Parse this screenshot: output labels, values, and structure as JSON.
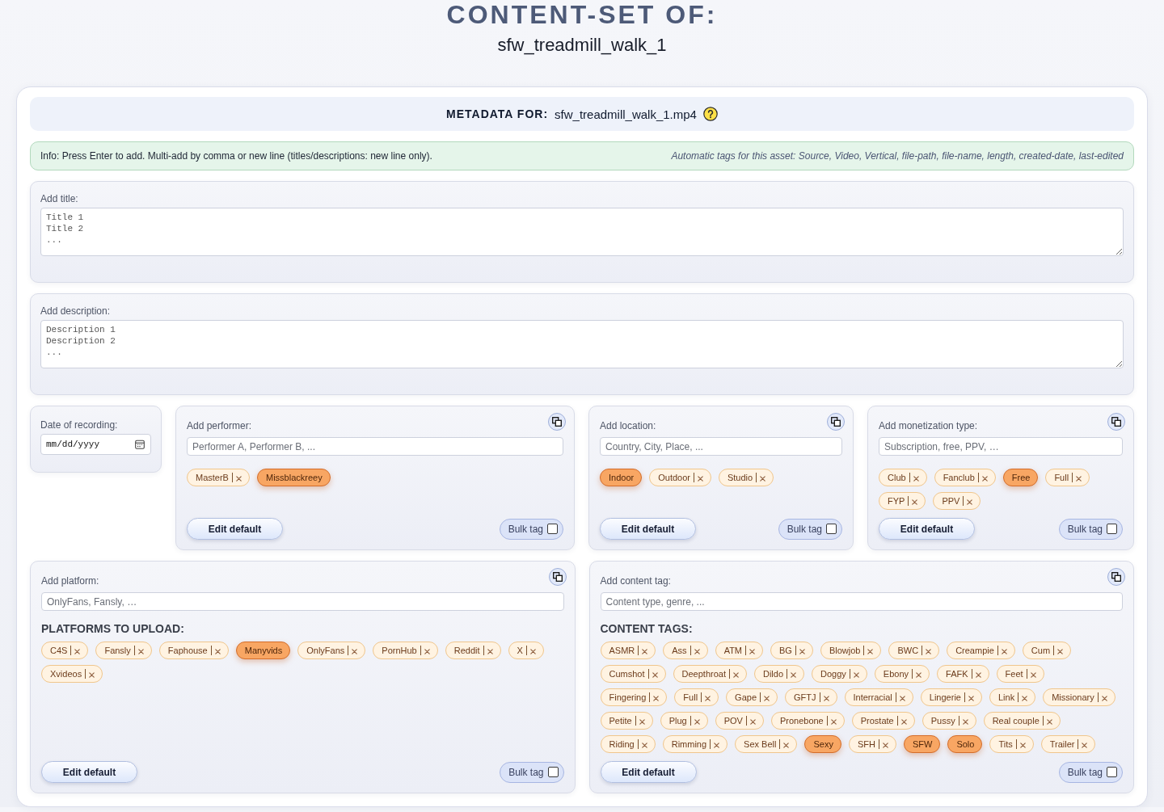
{
  "header": {
    "title": "CONTENT-SET OF:",
    "subtitle": "sfw_treadmill_walk_1"
  },
  "metadata_bar": {
    "label": "METADATA FOR:",
    "filename": "sfw_treadmill_walk_1.mp4"
  },
  "info_bar": {
    "hint": "Info: Press Enter to add. Multi-add by comma or new line (titles/descriptions: new line only).",
    "automatic_tags": "Automatic tags for this asset: Source, Video, Vertical, file-path, file-name, length, created-date, last-edited"
  },
  "text_fields": [
    {
      "label": "Add title:",
      "placeholder": "Title 1\nTitle 2\n..."
    },
    {
      "label": "Add description:",
      "placeholder": "Description 1\nDescription 2\n..."
    }
  ],
  "date_field": {
    "label": "Date of recording:",
    "placeholder": "mm/dd/yyyy"
  },
  "tag_panels": [
    {
      "label": "Add performer:",
      "placeholder": "Performer A, Performer B, ...",
      "tags": [
        {
          "label": "MasterB",
          "selected": false
        },
        {
          "label": "Missblackreey",
          "selected": true
        }
      ],
      "edit_button": "Edit default",
      "bulk_tag": {
        "label": "Bulk tag",
        "checked": false
      }
    },
    {
      "label": "Add location:",
      "placeholder": "Country, City, Place, ...",
      "tags": [
        {
          "label": "Indoor",
          "selected": true
        },
        {
          "label": "Outdoor",
          "selected": false
        },
        {
          "label": "Studio",
          "selected": false
        }
      ],
      "edit_button": "Edit default",
      "bulk_tag": {
        "label": "Bulk tag",
        "checked": false
      }
    },
    {
      "label": "Add monetization type:",
      "placeholder": "Subscription, free, PPV, …",
      "tags": [
        {
          "label": "Club",
          "selected": false
        },
        {
          "label": "Fanclub",
          "selected": false
        },
        {
          "label": "Free",
          "selected": true
        },
        {
          "label": "Full",
          "selected": false
        },
        {
          "label": "FYP",
          "selected": false
        },
        {
          "label": "PPV",
          "selected": false
        }
      ],
      "edit_button": "Edit default",
      "bulk_tag": {
        "label": "Bulk tag",
        "checked": false
      }
    },
    {
      "label": "Add platform:",
      "placeholder": "OnlyFans, Fansly, …",
      "heading": "PLATFORMS TO UPLOAD:",
      "tags": [
        {
          "label": "C4S",
          "selected": false
        },
        {
          "label": "Fansly",
          "selected": false
        },
        {
          "label": "Faphouse",
          "selected": false
        },
        {
          "label": "Manyvids",
          "selected": true
        },
        {
          "label": "OnlyFans",
          "selected": false
        },
        {
          "label": "PornHub",
          "selected": false
        },
        {
          "label": "Reddit",
          "selected": false
        },
        {
          "label": "X",
          "selected": false
        },
        {
          "label": "Xvideos",
          "selected": false
        }
      ],
      "edit_button": "Edit default",
      "bulk_tag": {
        "label": "Bulk tag",
        "checked": false
      }
    },
    {
      "label": "Add content tag:",
      "placeholder": "Content type, genre, ...",
      "heading": "CONTENT TAGS:",
      "tags": [
        {
          "label": "ASMR",
          "selected": false
        },
        {
          "label": "Ass",
          "selected": false
        },
        {
          "label": "ATM",
          "selected": false
        },
        {
          "label": "BG",
          "selected": false
        },
        {
          "label": "Blowjob",
          "selected": false
        },
        {
          "label": "BWC",
          "selected": false
        },
        {
          "label": "Creampie",
          "selected": false
        },
        {
          "label": "Cum",
          "selected": false
        },
        {
          "label": "Cumshot",
          "selected": false
        },
        {
          "label": "Deepthroat",
          "selected": false
        },
        {
          "label": "Dildo",
          "selected": false
        },
        {
          "label": "Doggy",
          "selected": false
        },
        {
          "label": "Ebony",
          "selected": false
        },
        {
          "label": "FAFK",
          "selected": false
        },
        {
          "label": "Feet",
          "selected": false
        },
        {
          "label": "Fingering",
          "selected": false
        },
        {
          "label": "Full",
          "selected": false
        },
        {
          "label": "Gape",
          "selected": false
        },
        {
          "label": "GFTJ",
          "selected": false
        },
        {
          "label": "Interracial",
          "selected": false
        },
        {
          "label": "Lingerie",
          "selected": false
        },
        {
          "label": "Link",
          "selected": false
        },
        {
          "label": "Missionary",
          "selected": false
        },
        {
          "label": "Petite",
          "selected": false
        },
        {
          "label": "Plug",
          "selected": false
        },
        {
          "label": "POV",
          "selected": false
        },
        {
          "label": "Pronebone",
          "selected": false
        },
        {
          "label": "Prostate",
          "selected": false
        },
        {
          "label": "Pussy",
          "selected": false
        },
        {
          "label": "Real couple",
          "selected": false
        },
        {
          "label": "Riding",
          "selected": false
        },
        {
          "label": "Rimming",
          "selected": false
        },
        {
          "label": "Sex Bell",
          "selected": false
        },
        {
          "label": "Sexy",
          "selected": true
        },
        {
          "label": "SFH",
          "selected": false
        },
        {
          "label": "SFW",
          "selected": true
        },
        {
          "label": "Solo",
          "selected": true
        },
        {
          "label": "Tits",
          "selected": false
        },
        {
          "label": "Trailer",
          "selected": false
        }
      ],
      "edit_button": "Edit default",
      "bulk_tag": {
        "label": "Bulk tag",
        "checked": false
      }
    }
  ]
}
